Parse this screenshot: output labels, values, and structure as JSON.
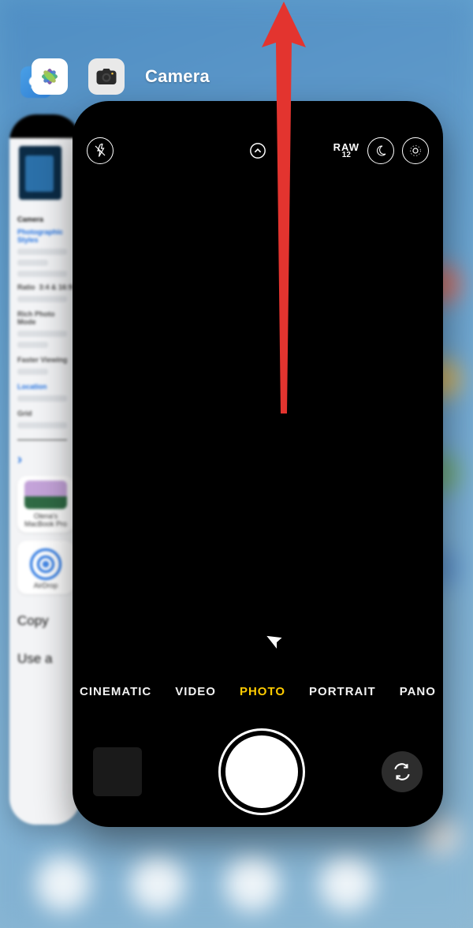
{
  "header": {
    "app_label": "Camera"
  },
  "back_card": {
    "title": "Camera",
    "section1": "Photographic Styles",
    "ratio_label": "Ratio",
    "ratio_value": "3:4 & 16:9",
    "section2": "Rich Photo Mode",
    "section3": "Faster Viewing",
    "section4": "Location",
    "section5": "Grid",
    "device_name": "Olena's",
    "device_sub": "MacBook Pro",
    "airdrop_label": "AirDrop",
    "action_copy": "Copy",
    "action_use": "Use a"
  },
  "camera": {
    "raw_label": "RAW",
    "raw_sub": "12",
    "modes": {
      "cinematic": "CINEMATIC",
      "video": "VIDEO",
      "photo": "PHOTO",
      "portrait": "PORTRAIT",
      "pano": "PANO"
    }
  },
  "annotation": {
    "arrow_color": "#e3342f"
  }
}
